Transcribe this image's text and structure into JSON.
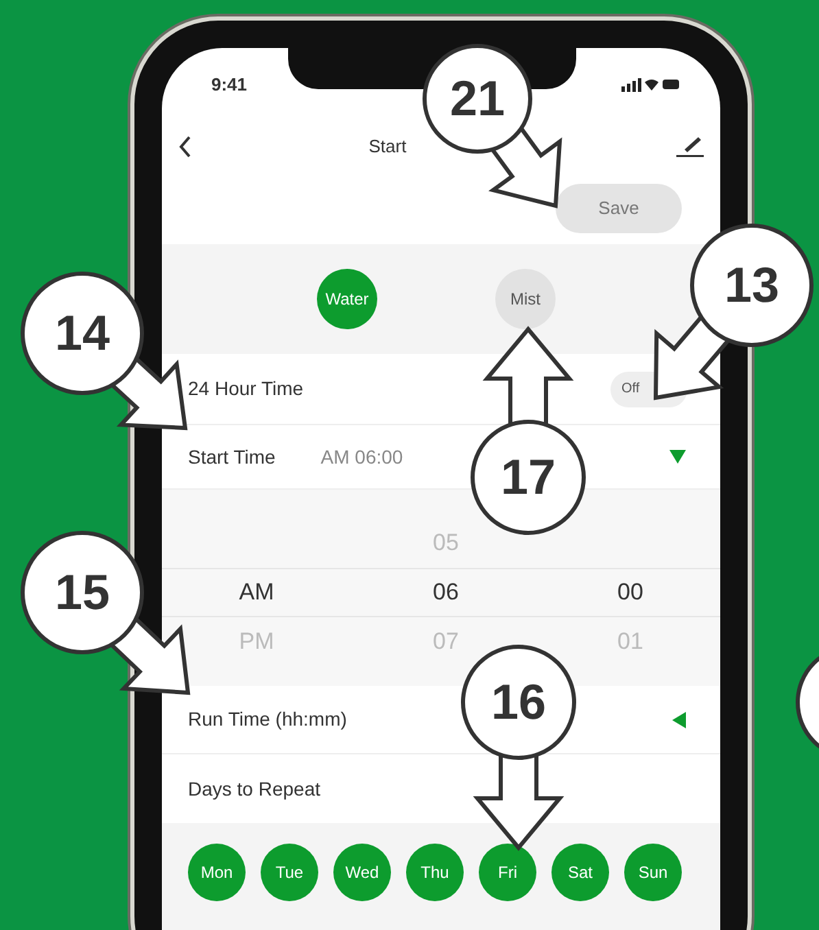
{
  "status_bar": {
    "time": "9:41"
  },
  "nav": {
    "title": "Start"
  },
  "save_button": "Save",
  "modes": [
    {
      "label": "Water",
      "selected": true
    },
    {
      "label": "Mist",
      "selected": false
    }
  ],
  "hour_24": {
    "label": "24 Hour Time",
    "on": false,
    "toggle_text": "Off"
  },
  "start_time": {
    "label": "Start Time",
    "value": "AM 06:00",
    "expanded": true
  },
  "picker": [
    {
      "hour": "05",
      "selected": false
    },
    {
      "period": "AM",
      "hour": "06",
      "minute": "00",
      "selected": true
    },
    {
      "period": "PM",
      "hour": "07",
      "minute": "01",
      "selected": false
    }
  ],
  "run_time": {
    "label": "Run Time (hh:mm)",
    "expanded": false
  },
  "days_label": "Days to Repeat",
  "days": [
    {
      "label": "Mon",
      "selected": true
    },
    {
      "label": "Tue",
      "selected": true
    },
    {
      "label": "Wed",
      "selected": true
    },
    {
      "label": "Thu",
      "selected": true
    },
    {
      "label": "Fri",
      "selected": true
    },
    {
      "label": "Sat",
      "selected": true
    },
    {
      "label": "Sun",
      "selected": true
    }
  ],
  "callouts": [
    {
      "number": "21"
    },
    {
      "number": "13"
    },
    {
      "number": "14"
    },
    {
      "number": "15"
    },
    {
      "number": "16"
    },
    {
      "number": "17"
    }
  ]
}
